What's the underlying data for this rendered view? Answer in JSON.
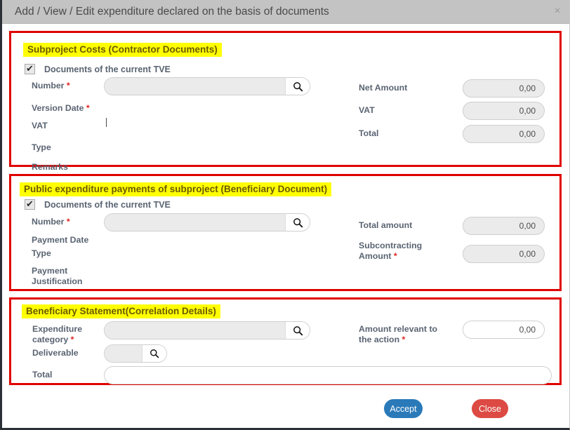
{
  "window": {
    "title": "Add / View / Edit expenditure declared on the basis of documents",
    "close_icon": "close-icon",
    "close_glyph": "×"
  },
  "icons": {
    "search": "search-icon",
    "checkmark": "check-icon"
  },
  "sections": [
    {
      "id": "subproject-costs",
      "title": "Subproject Costs (Contractor Documents)",
      "checkbox": {
        "label": "Documents of the current TVE",
        "checked": true
      },
      "left_fields": [
        {
          "label": "Number",
          "required": true,
          "control": "lookup",
          "value": ""
        },
        {
          "label": "Version Date",
          "required": true,
          "control": "none",
          "value": ""
        },
        {
          "label": "VAT",
          "required": false,
          "control": "caret",
          "value": ""
        },
        {
          "label": "Type",
          "required": false,
          "control": "none",
          "value": ""
        },
        {
          "label": "Remarks",
          "required": false,
          "control": "none",
          "value": ""
        }
      ],
      "right_fields": [
        {
          "label": "Net Amount",
          "required": false,
          "value": "0,00"
        },
        {
          "label": "VAT",
          "required": false,
          "value": "0,00"
        },
        {
          "label": "Total",
          "required": false,
          "value": "0,00"
        }
      ]
    },
    {
      "id": "public-expenditure-payments",
      "title": "Public expenditure payments of subproject (Beneficiary Document)",
      "checkbox": {
        "label": "Documents of the current TVE",
        "checked": true
      },
      "left_fields": [
        {
          "label": "Number",
          "required": true,
          "control": "lookup",
          "value": ""
        },
        {
          "label": "Payment Date",
          "required": false,
          "control": "none",
          "value": ""
        },
        {
          "label": "Type",
          "required": false,
          "control": "none",
          "value": ""
        },
        {
          "label": "Payment Justification",
          "required": false,
          "control": "none",
          "value": ""
        }
      ],
      "right_fields": [
        {
          "label": "Total amount",
          "required": false,
          "value": "0,00"
        },
        {
          "label": "Subcontracting Amount",
          "required": true,
          "value": "0,00"
        }
      ]
    },
    {
      "id": "beneficiary-statement",
      "title": "Beneficiary Statement(Correlation Details)",
      "left_fields": [
        {
          "label": "Expenditure category",
          "required": true,
          "control": "lookup",
          "value": ""
        },
        {
          "label": "Deliverable",
          "required": false,
          "control": "lookup-small",
          "value": ""
        },
        {
          "label": "Total",
          "required": false,
          "control": "wide-input",
          "value": ""
        }
      ],
      "right_fields": [
        {
          "label": "Amount relevant to the action",
          "required": true,
          "value": "0,00"
        }
      ]
    }
  ],
  "footer": {
    "accept_label": "Accept",
    "close_label": "Close"
  },
  "colors": {
    "frame_red": "#e00000",
    "highlight_yellow": "#ffff00",
    "title_bar": "#c3c3c3",
    "accept_blue": "#2a7ab9",
    "close_red": "#dc4a43",
    "label_gray": "#5a6472",
    "required_red": "#e02020"
  }
}
